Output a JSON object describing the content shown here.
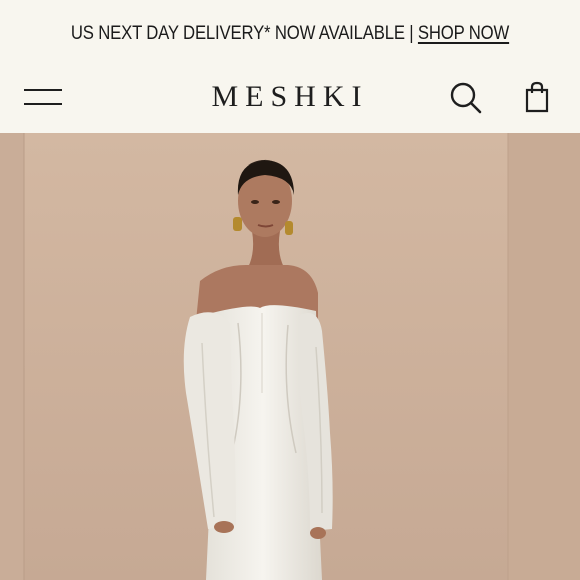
{
  "announcement": {
    "text": "US NEXT DAY DELIVERY* NOW AVAILABLE | ",
    "link_label": "SHOP NOW"
  },
  "header": {
    "brand": "MESHKI",
    "menu_icon": "hamburger-menu-icon",
    "search_icon": "search-icon",
    "bag_icon": "shopping-bag-icon"
  },
  "hero": {
    "image_subject": "model in white off-shoulder satin maxi dress",
    "colors": {
      "background": "#cdb29c",
      "dress": "#f1efe9",
      "skin": "#a9755c",
      "hair": "#1f1711"
    }
  },
  "colors": {
    "page_background": "#f8f6ef",
    "text": "#1b1b1b"
  }
}
